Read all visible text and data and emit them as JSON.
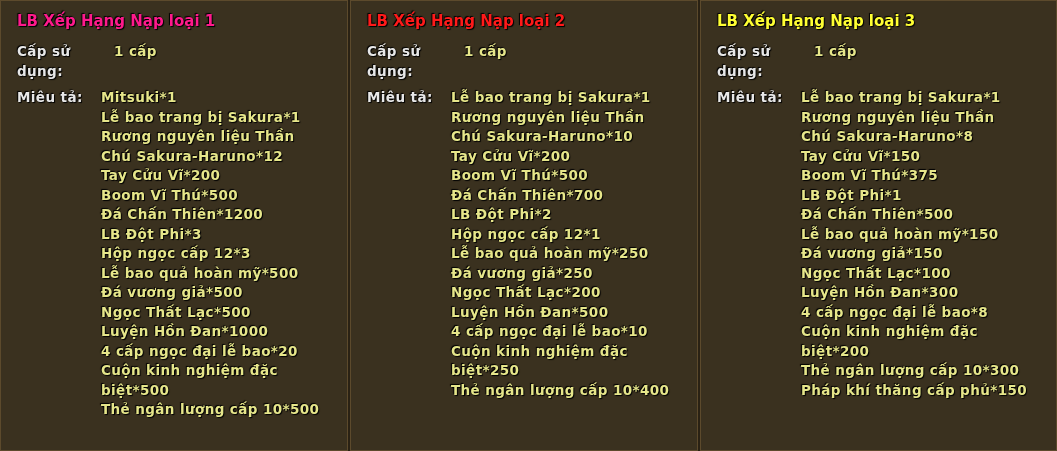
{
  "panels": [
    {
      "title": "LB Xếp Hạng Nạp loại 1",
      "color": "#ff1a8c",
      "level_label": "Cấp sử dụng:",
      "level_value": "1 cấp",
      "desc_label": "Miêu tả:",
      "items": [
        "Mitsuki*1",
        "Lễ bao trang bị Sakura*1",
        "Rương nguyên liệu Thần",
        "Chú Sakura-Haruno*12",
        "Tay Cửu Vĩ*200",
        "Boom Vĩ Thú*500",
        "Đá Chấn Thiên*1200",
        "LB Đột Phi*3",
        "Hộp ngọc cấp 12*3",
        "Lễ bao quả hoàn mỹ*500",
        "Đá vương giả*500",
        "Ngọc Thất Lạc*500",
        "Luyện Hồn Đan*1000",
        "4 cấp ngọc đại lễ bao*20",
        "Cuộn kinh nghiệm đặc biệt*500",
        "Thẻ ngân lượng cấp 10*500"
      ]
    },
    {
      "title": "LB Xếp Hạng Nạp loại 2",
      "color": "#ff1a1a",
      "level_label": "Cấp sử dụng:",
      "level_value": "1 cấp",
      "desc_label": "Miêu tả:",
      "items": [
        "Lễ bao trang bị Sakura*1",
        "Rương nguyên liệu Thần",
        "Chú Sakura-Haruno*10",
        "Tay Cửu Vĩ*200",
        "Boom Vĩ Thú*500",
        "Đá Chấn Thiên*700",
        "LB Đột Phi*2",
        "Hộp ngọc cấp 12*1",
        "Lễ bao quả hoàn mỹ*250",
        "Đá vương giả*250",
        "Ngọc Thất Lạc*200",
        "Luyện Hồn Đan*500",
        "4 cấp ngọc đại lễ bao*10",
        "Cuộn kinh nghiệm đặc biệt*250",
        "Thẻ ngân lượng cấp 10*400"
      ]
    },
    {
      "title": "LB Xếp Hạng Nạp loại 3",
      "color": "#ffff33",
      "level_label": "Cấp sử dụng:",
      "level_value": "1 cấp",
      "desc_label": "Miêu tả:",
      "items": [
        "Lễ bao trang bị Sakura*1",
        "Rương nguyên liệu Thần",
        "Chú Sakura-Haruno*8",
        "Tay Cửu Vĩ*150",
        "Boom Vĩ Thú*375",
        "LB Đột Phi*1",
        "Đá Chấn Thiên*500",
        "Lễ bao quả hoàn mỹ*150",
        "Đá vương giả*150",
        "Ngọc Thất Lạc*100",
        "Luyện Hồn Đan*300",
        "4 cấp ngọc đại lễ bao*8",
        "Cuộn kinh nghiệm đặc biệt*200",
        "Thẻ ngân lượng cấp 10*300",
        "Pháp khí thăng cấp phủ*150"
      ]
    }
  ]
}
